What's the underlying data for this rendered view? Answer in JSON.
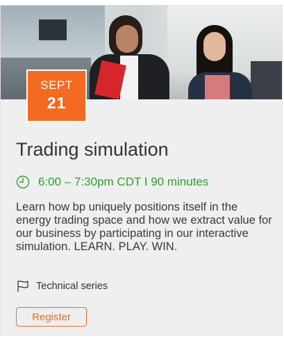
{
  "event": {
    "date": {
      "month": "SEPT",
      "day": "21"
    },
    "title": "Trading simulation",
    "time": "6:00 – 7:30pm CDT I 90 minutes",
    "description": "Learn how bp uniquely positions itself in the energy trading space and how we extract value for our business by participating in our interactive simulation. LEARN. PLAY. WIN.",
    "series": "Technical series",
    "register_label": "Register"
  },
  "colors": {
    "accent": "#f36a23",
    "time": "#2f9e2f",
    "card_bg": "#efefef"
  },
  "icons": {
    "time": "clock-icon",
    "series": "flag-icon"
  }
}
